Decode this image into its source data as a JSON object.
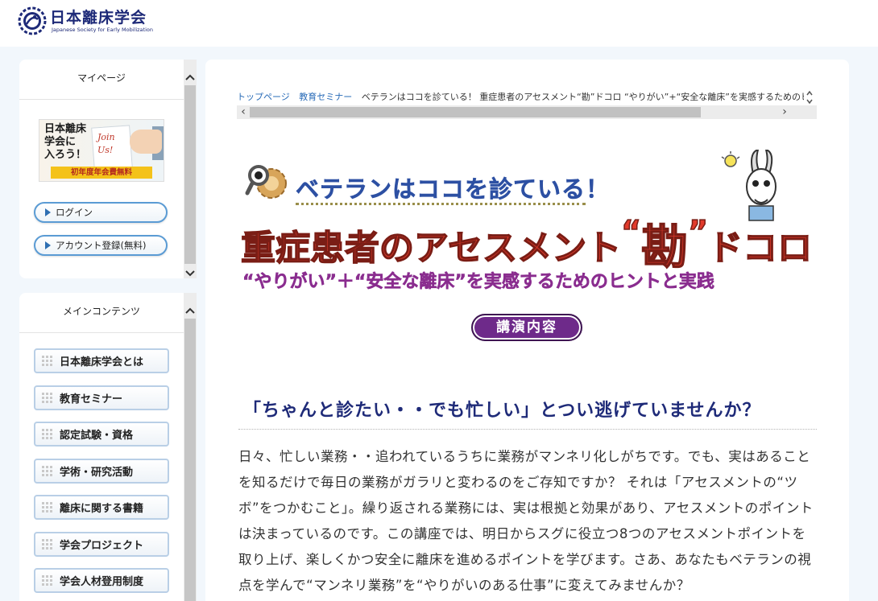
{
  "header": {
    "logo_jp": "日本離床学会",
    "logo_en": "Japanese Society for Early Mobilization"
  },
  "sidebar_mypage": {
    "title": "マイページ",
    "banner": {
      "text": "日本離床\n学会に\n入ろう！",
      "card_text": "Join\nUs!",
      "ribbon": "初年度年会費無料"
    },
    "login_label": "ログイン",
    "register_label": "アカウント登録(無料)"
  },
  "sidebar_main": {
    "title": "メインコンテンツ",
    "items": [
      {
        "label": "日本離床学会とは"
      },
      {
        "label": "教育セミナー"
      },
      {
        "label": "認定試験・資格"
      },
      {
        "label": "学術・研究活動"
      },
      {
        "label": "離床に関する書籍"
      },
      {
        "label": "学会プロジェクト"
      },
      {
        "label": "学会人材登用制度"
      }
    ]
  },
  "breadcrumb": {
    "home": "トップページ",
    "seminar": "教育セミナー",
    "current": "ベテランはココを診ている！ 重症患者のアセスメント“勘”ドコロ “やりがい”+“安全な離床”を実感するためのヒントと実践"
  },
  "hero": {
    "subtitle": "ベテランはココを診ている！",
    "title_pre": "重症患者のアセスメント",
    "title_quote_open": "“",
    "title_kanji": "勘",
    "title_quote_close": "”",
    "title_post": "ドコロ",
    "tagline": "“やりがい”＋“安全な離床”を実感するためのヒントと実践",
    "button_label": "講演内容"
  },
  "section": {
    "heading": "「ちゃんと診たい・・でも忙しい」とつい逃げていませんか？",
    "body": "日々、忙しい業務・・追われているうちに業務がマンネリ化しがちです。でも、実はあることを知るだけで毎日の業務がガラリと変わるのをご存知ですか？ それは「アセスメントの“ツボ”をつかむこと」。繰り返される業務には、実は根拠と効果があり、アセスメントのポイントは決まっているのです。この講座では、明日からスグに役立つ8つのアセスメントポイントを取り上げ、楽しくかつ安全に離床を進めるポイントを学びます。さあ、あなたもベテランの視点を学んで“マンネリ業務”を“やりがいのある仕事”に変えてみませんか？"
  },
  "colors": {
    "brand_navy": "#1e2a78",
    "title_red": "#e23a2b",
    "tagline_purple": "#8a2d8f",
    "button_purple": "#6e2a8a",
    "link_blue": "#2a6cb8"
  }
}
